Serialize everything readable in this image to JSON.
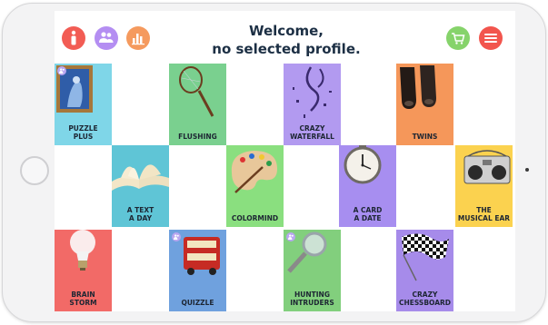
{
  "header": {
    "welcome_line1": "Welcome,",
    "welcome_line2": "no selected profile.",
    "buttons": [
      {
        "icon": "person-info-icon",
        "color": "#f25c54"
      },
      {
        "icon": "group-icon",
        "color": "#b48ef2"
      },
      {
        "icon": "stats-chart-icon",
        "color": "#f59a5e"
      },
      {
        "icon": "cart-icon",
        "color": "#86d36b"
      },
      {
        "icon": "menu-icon",
        "color": "#f2554d"
      }
    ]
  },
  "tiles": [
    {
      "label": "PUZZLE\nPLUS",
      "color": "#7fd6e8",
      "icon": "painting-icon",
      "badge": true
    },
    {
      "label": "FLUSHING",
      "color": "#7ad08f",
      "icon": "racket-icon",
      "badge": false
    },
    {
      "label": "CRAZY\nWATERFALL",
      "color": "#b29af0",
      "icon": "confetti-icon",
      "badge": false
    },
    {
      "label": "TWINS",
      "color": "#f5975a",
      "icon": "shoes-icon",
      "badge": false
    },
    {
      "label": "A TEXT\nA DAY",
      "color": "#5fc5d6",
      "icon": "book-icon",
      "badge": false
    },
    {
      "label": "COLORMIND",
      "color": "#8adf7f",
      "icon": "palette-icon",
      "badge": false
    },
    {
      "label": "A CARD\nA DATE",
      "color": "#a78ef0",
      "icon": "clock-icon",
      "badge": false
    },
    {
      "label": "THE\nMUSICAL EAR",
      "color": "#fbd24f",
      "icon": "radio-icon",
      "badge": false
    },
    {
      "label": "BRAIN\nSTORM",
      "color": "#f26a67",
      "icon": "lightbulb-icon",
      "badge": false
    },
    {
      "label": "QUIZZLE",
      "color": "#6fa1de",
      "icon": "bus-icon",
      "badge": true
    },
    {
      "label": "HUNTING\nINTRUDERS",
      "color": "#82cf7d",
      "icon": "magnifier-icon",
      "badge": true
    },
    {
      "label": "CRAZY\nCHESSBOARD",
      "color": "#a68bea",
      "icon": "checkered-flag-icon",
      "badge": false
    }
  ]
}
